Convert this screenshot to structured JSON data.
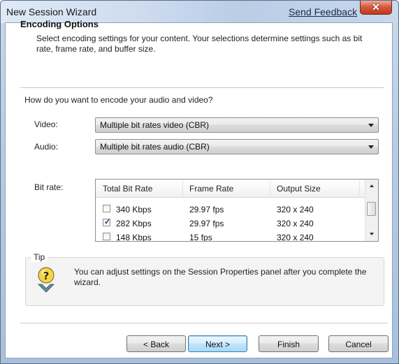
{
  "window": {
    "title": "New Session Wizard",
    "feedback_link": "Send Feedback",
    "close_glyph": "✕"
  },
  "header": {
    "title": "Encoding Options",
    "description": "Select encoding settings for your content. Your selections determine settings such as bit rate, frame rate, and buffer size."
  },
  "question": "How do you want to encode your audio and video?",
  "video": {
    "label": "Video:",
    "value": "Multiple bit rates video (CBR)"
  },
  "audio": {
    "label": "Audio:",
    "value": "Multiple bit rates audio (CBR)"
  },
  "bitrate": {
    "label": "Bit rate:",
    "columns": [
      "Total Bit Rate",
      "Frame Rate",
      "Output Size"
    ],
    "rows": [
      {
        "checked": false,
        "rate": "340 Kbps",
        "fps": "29.97 fps",
        "size": "320 x 240"
      },
      {
        "checked": true,
        "rate": "282 Kbps",
        "fps": "29.97 fps",
        "size": "320 x 240"
      },
      {
        "checked": false,
        "rate": "148 Kbps",
        "fps": "15 fps",
        "size": "320 x 240"
      }
    ]
  },
  "tip": {
    "label": "Tip",
    "icon": "lightbulb-tip-icon",
    "text": "You can adjust settings on the Session Properties panel after you complete the wizard."
  },
  "buttons": {
    "back": "< Back",
    "next": "Next >",
    "finish": "Finish",
    "cancel": "Cancel"
  },
  "colors": {
    "close_button": "#d5543a",
    "default_button_border": "#3c7fb1"
  }
}
